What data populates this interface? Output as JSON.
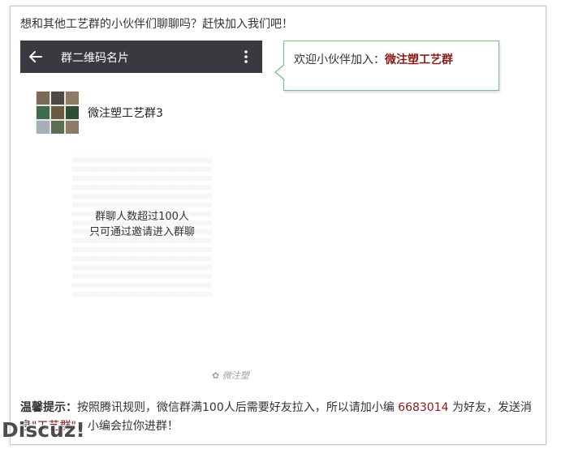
{
  "intro_text": "想和其他工艺群的小伙伴们聊聊吗？赶快加入我们吧！",
  "phone": {
    "topbar_title": "群二维码名片",
    "back_icon": "back-arrow-icon",
    "more_icon": "more-vertical-icon",
    "topbar_color": "#393a3f",
    "group_name": "微注塑工艺群3",
    "qr_note_line1": "群聊人数超过100人",
    "qr_note_line2": "只可通过邀请进入群聊"
  },
  "bubble": {
    "prefix": "欢迎小伙伴加入：",
    "highlight": "微注塑工艺群",
    "border_color": "#7cbf8b",
    "highlight_color": "#8b1a1a"
  },
  "watermark_mid": "微注塑",
  "tip": {
    "label": "温馨提示：",
    "text_before_number": "按照腾讯规则，微信群满100人后需要好友拉入，所以请加小编 ",
    "number": "6683014",
    "text_after_number": " 为好友，发送消息",
    "quote": "\"工艺群\"",
    "text_end": "，小编会拉你进群！"
  },
  "discuz_watermark": "Discuz!"
}
